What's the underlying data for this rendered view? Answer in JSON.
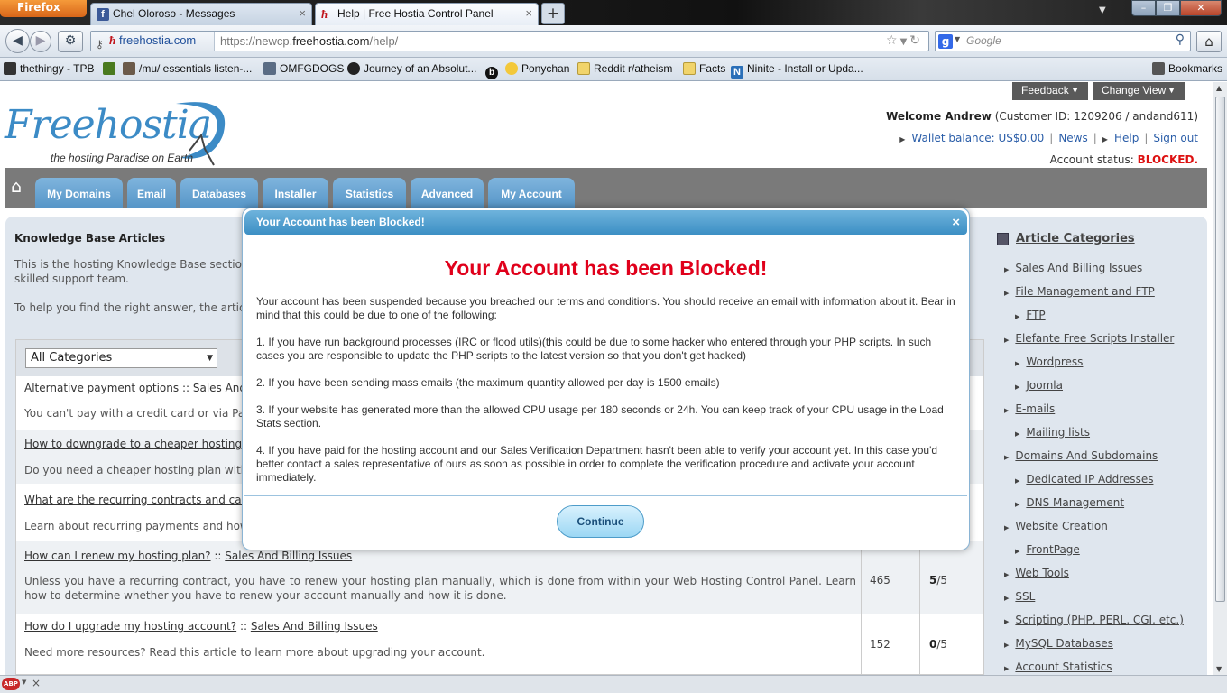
{
  "browser": {
    "app_button": "Firefox",
    "tabs": [
      {
        "label": "Chel Oloroso - Messages",
        "close": "×"
      },
      {
        "label": "Help | Free Hostia Control Panel",
        "close": "×"
      }
    ],
    "newtab": "+",
    "tablist": "▼",
    "window_buttons": {
      "minimize": "–",
      "restore": "❐",
      "close": "✕"
    },
    "site_identity": "freehostia.com",
    "url_prefix": "https://newcp.",
    "url_domain": "freehostia.com",
    "url_path": "/help/",
    "search_placeholder": "Google",
    "bookmarks": [
      "thethingy - TPB",
      "/mu/ essentials listen-...",
      "OMFGDOGS",
      "Journey of an Absolut...",
      "Ponychan",
      "Reddit r/atheism",
      "Facts",
      "Ninite - Install or Upda..."
    ],
    "bookmarks_menu": "Bookmarks"
  },
  "page": {
    "feedback_btn": "Feedback",
    "changeview_btn": "Change View",
    "logo_text": "Freehostia",
    "tagline": "the hosting Paradise on Earth",
    "welcome_label": "Welcome Andrew",
    "customer_info": "(Customer ID: 1209206 / andand611)",
    "links": {
      "wallet": "Wallet balance: US$0.00",
      "news": "News",
      "help": "Help",
      "signout": "Sign out",
      "sep": "|"
    },
    "account_status_label": "Account status:",
    "account_status_value": "BLOCKED.",
    "menu": [
      "My Domains",
      "Email",
      "Databases",
      "Installer",
      "Statistics",
      "Advanced",
      "My Account"
    ],
    "kb": {
      "title": "Knowledge Base Articles",
      "intro1a": "This is the hosting Knowledge Base section, w",
      "intro1b": "skilled support team.",
      "intro2": "To help you find the right answer, the articles",
      "category_select": "All Categories"
    },
    "articles": [
      {
        "title": "Alternative payment options",
        "sep": " :: ",
        "cat": "Sales And Bill",
        "desc": "You can't pay with a credit card or via PayPa",
        "views": "",
        "rating": "",
        "out_of": ""
      },
      {
        "title": "How to downgrade to a cheaper hosting pla",
        "sep": "",
        "cat": "",
        "desc": "Do you need a cheaper hosting plan with les",
        "views": "",
        "rating": "",
        "out_of": ""
      },
      {
        "title": "What are the recurring contracts and can I",
        "sep": "",
        "cat": "",
        "desc": "Learn about recurring payments and how yo",
        "views": "",
        "rating": "",
        "out_of": ""
      },
      {
        "title": "How can I renew my hosting plan?",
        "sep": " :: ",
        "cat": "Sales And Billing Issues",
        "desc": "Unless you have a recurring contract, you have to renew your hosting plan manually, which is done from within your Web Hosting Control Panel. Learn how to determine whether you have to renew your account manually and how it is done.",
        "views": "465",
        "rating": "5",
        "out_of": "/5"
      },
      {
        "title": "How do I upgrade my hosting account?",
        "sep": " :: ",
        "cat": "Sales And Billing Issues",
        "desc": "Need more resources? Read this article to learn more about upgrading your account.",
        "views": "152",
        "rating": "0",
        "out_of": "/5"
      }
    ],
    "categories_title": "Article Categories",
    "categories": [
      {
        "label": "Sales And Billing Issues",
        "level": 0
      },
      {
        "label": "File Management and FTP",
        "level": 0
      },
      {
        "label": "FTP",
        "level": 1
      },
      {
        "label": "Elefante Free Scripts Installer",
        "level": 0
      },
      {
        "label": "Wordpress",
        "level": 1
      },
      {
        "label": "Joomla",
        "level": 1
      },
      {
        "label": "E-mails",
        "level": 0
      },
      {
        "label": "Mailing lists",
        "level": 1
      },
      {
        "label": "Domains And Subdomains",
        "level": 0
      },
      {
        "label": "Dedicated IP Addresses",
        "level": 1
      },
      {
        "label": "DNS Management",
        "level": 1
      },
      {
        "label": "Website Creation",
        "level": 0
      },
      {
        "label": "FrontPage",
        "level": 1
      },
      {
        "label": "Web Tools",
        "level": 0
      },
      {
        "label": "SSL",
        "level": 0
      },
      {
        "label": "Scripting (PHP, PERL, CGI, etc.)",
        "level": 0
      },
      {
        "label": "MySQL Databases",
        "level": 0
      },
      {
        "label": "Account Statistics",
        "level": 0
      }
    ]
  },
  "dialog": {
    "bar_title": "Your Account has been Blocked!",
    "close": "×",
    "heading": "Your Account has been Blocked!",
    "p1": "Your account has been suspended because you breached our terms and conditions. You should receive an email with information about it. Bear in mind that this could be due to one of the following:",
    "p2": "1. If you have run background processes (IRC or flood utils)(this could be due to some hacker who entered through your PHP scripts. In such cases you are responsible to update the PHP scripts to the latest version so that you don't get hacked)",
    "p3": "2. If you have been sending mass emails (the maximum quantity allowed per day is 1500 emails)",
    "p4": "3. If your website has generated more than the allowed CPU usage per 180 seconds or 24h. You can keep track of your CPU usage in the Load Stats section.",
    "p5": "4. If you have paid for the hosting account and our Sales Verification Department hasn't been able to verify your account yet. In this case you'd better contact a sales representative of ours as soon as possible in order to complete the verification procedure and activate your account immediately.",
    "button": "Continue"
  },
  "statusbar": {
    "abp": "ABP",
    "close": "×"
  },
  "colors": {
    "brand_blue": "#3c8bc6",
    "blocked_red": "#e0001b",
    "menu_tab": "#5595c7"
  }
}
